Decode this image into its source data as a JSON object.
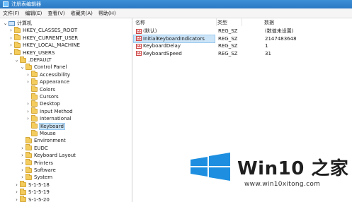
{
  "window": {
    "title": "注册表编辑器"
  },
  "menu": [
    "文件(F)",
    "编辑(E)",
    "查看(V)",
    "收藏夹(A)",
    "帮助(H)"
  ],
  "tree": [
    {
      "label": "计算机",
      "indent": 0,
      "expander": "v",
      "icon": "pc"
    },
    {
      "label": "HKEY_CLASSES_ROOT",
      "indent": 1,
      "expander": ">",
      "icon": "folder"
    },
    {
      "label": "HKEY_CURRENT_USER",
      "indent": 1,
      "expander": ">",
      "icon": "folder"
    },
    {
      "label": "HKEY_LOCAL_MACHINE",
      "indent": 1,
      "expander": ">",
      "icon": "folder"
    },
    {
      "label": "HKEY_USERS",
      "indent": 1,
      "expander": "v",
      "icon": "folder"
    },
    {
      "label": ".DEFAULT",
      "indent": 2,
      "expander": "v",
      "icon": "folder"
    },
    {
      "label": "Control Panel",
      "indent": 3,
      "expander": "v",
      "icon": "folder"
    },
    {
      "label": "Accessibility",
      "indent": 4,
      "expander": ">",
      "icon": "folder"
    },
    {
      "label": "Appearance",
      "indent": 4,
      "expander": ">",
      "icon": "folder"
    },
    {
      "label": "Colors",
      "indent": 4,
      "expander": "",
      "icon": "folder"
    },
    {
      "label": "Cursors",
      "indent": 4,
      "expander": "",
      "icon": "folder"
    },
    {
      "label": "Desktop",
      "indent": 4,
      "expander": ">",
      "icon": "folder"
    },
    {
      "label": "Input Method",
      "indent": 4,
      "expander": ">",
      "icon": "folder"
    },
    {
      "label": "International",
      "indent": 4,
      "expander": ">",
      "icon": "folder"
    },
    {
      "label": "Keyboard",
      "indent": 4,
      "expander": "",
      "icon": "folder",
      "selected": true
    },
    {
      "label": "Mouse",
      "indent": 4,
      "expander": "",
      "icon": "folder"
    },
    {
      "label": "Environment",
      "indent": 3,
      "expander": "",
      "icon": "folder"
    },
    {
      "label": "EUDC",
      "indent": 3,
      "expander": ">",
      "icon": "folder"
    },
    {
      "label": "Keyboard Layout",
      "indent": 3,
      "expander": ">",
      "icon": "folder"
    },
    {
      "label": "Printers",
      "indent": 3,
      "expander": ">",
      "icon": "folder"
    },
    {
      "label": "Software",
      "indent": 3,
      "expander": ">",
      "icon": "folder"
    },
    {
      "label": "System",
      "indent": 3,
      "expander": ">",
      "icon": "folder"
    },
    {
      "label": "S-1-5-18",
      "indent": 2,
      "expander": ">",
      "icon": "folder"
    },
    {
      "label": "S-1-5-19",
      "indent": 2,
      "expander": ">",
      "icon": "folder"
    },
    {
      "label": "S-1-5-20",
      "indent": 2,
      "expander": ">",
      "icon": "folder"
    }
  ],
  "columns": {
    "name": "名称",
    "type": "类型",
    "data": "数据"
  },
  "values": [
    {
      "name": "(默认)",
      "type": "REG_SZ",
      "data": "(数值未设置)"
    },
    {
      "name": "InitialKeyboardIndicators",
      "type": "REG_SZ",
      "data": "2147483648",
      "selected": true
    },
    {
      "name": "KeyboardDelay",
      "type": "REG_SZ",
      "data": "1"
    },
    {
      "name": "KeyboardSpeed",
      "type": "REG_SZ",
      "data": "31"
    }
  ],
  "watermark": {
    "brand": "Win10 之家",
    "site": "www.win10xitong.com"
  },
  "colors": {
    "titlebar": "#2a78c4",
    "selection": "#cce4f7",
    "logo_blue": "#1e8fe0"
  },
  "icons": {
    "tree_node": "folder-icon",
    "root": "computer-icon",
    "value": "string-value-icon"
  }
}
